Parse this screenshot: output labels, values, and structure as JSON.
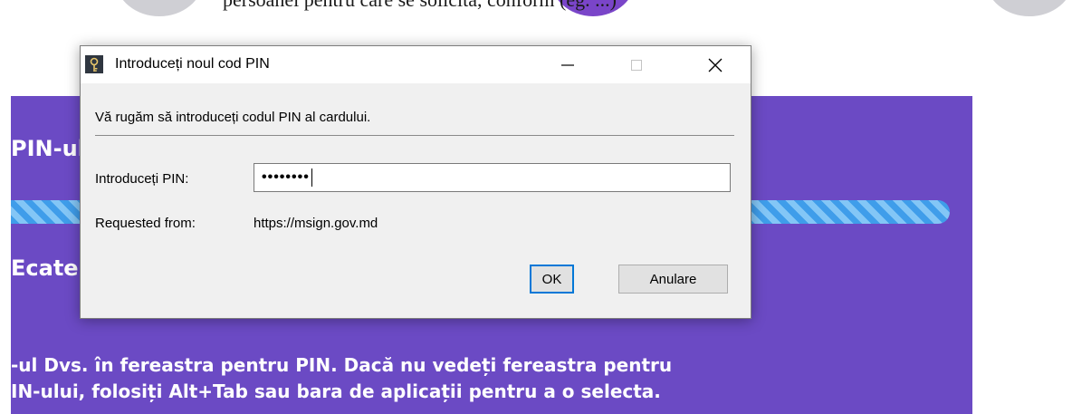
{
  "background_page": {
    "top_text": "persoanei pentru care se solicită, conform (eg. ...)",
    "panel_heading": "PIN-ul",
    "panel_subheading": "Ecaterina",
    "message_line1": "-ul Dvs. în fereastra pentru PIN. Dacă nu vedeți fereastra pentru",
    "message_line2": "IN-ului, folosiți Alt+Tab sau bara de aplicații pentru a o selecta.",
    "colors": {
      "panel": "#6b4ac4",
      "progress_stripe_dark": "#3f9dea",
      "progress_stripe_light": "#83c6f6"
    }
  },
  "dialog": {
    "title": "Introduceți noul cod PIN",
    "app_icon": "signature-key-icon",
    "instruction": "Vă rugăm să introduceți codul PIN al cardului.",
    "pin_label": "Introduceți PIN:",
    "pin_value": "••••••••",
    "requested_from_label": "Requested from:",
    "requested_from_value": "https://msign.gov.md",
    "ok_label": "OK",
    "cancel_label": "Anulare",
    "window_controls": [
      "minimize-icon",
      "maximize-icon",
      "close-icon"
    ]
  }
}
